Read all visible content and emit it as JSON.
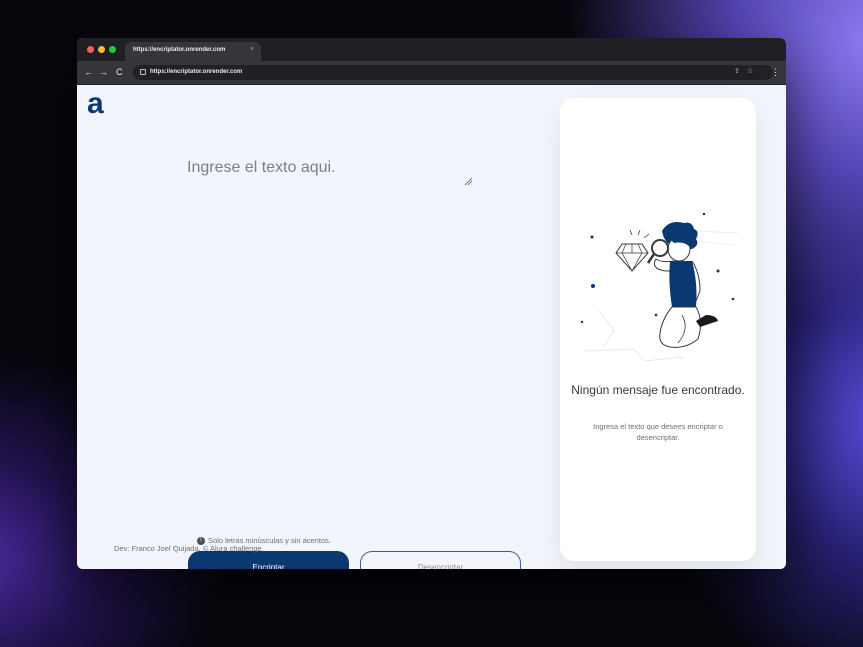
{
  "browser": {
    "tab_title": "https://encriptator.onrender.com",
    "tab_close": "×",
    "url": "https://encriptator.onrender.com",
    "nav": {
      "back": "←",
      "forward": "→",
      "reload": "C"
    },
    "icons": {
      "share": "⇪",
      "star": "☆",
      "menu": "⋮"
    }
  },
  "app": {
    "logo": "a",
    "input": {
      "placeholder": "Ingrese el texto aqui.",
      "value": ""
    },
    "hint": {
      "icon": "!",
      "text": "Solo letras minúsculas y sin acentos."
    },
    "buttons": {
      "encrypt": "Encriptar",
      "decrypt": "Desencriptar"
    },
    "footer": "Dev: Franco Joel Quijada. © Alura challenge"
  },
  "output_panel": {
    "illustration": "person-with-magnifying-glass-and-diamond",
    "title": "Ningún mensaje fue encontrado.",
    "subtitle": "Ingresa el texto que desees encriptar o desencriptar."
  },
  "colors": {
    "accent": "#0a3871",
    "page_bg": "#f3f5fc",
    "panel_bg": "#ffffff",
    "browser_dark": "#35363a"
  }
}
